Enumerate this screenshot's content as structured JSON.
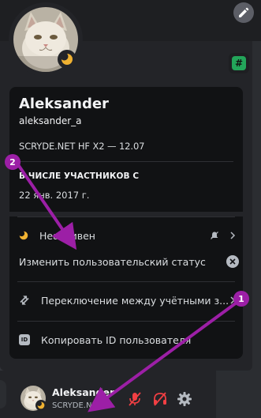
{
  "profile": {
    "display_name": "Aleksander",
    "username": "aleksander_a",
    "custom_status": "SCRYDE.NET HF X2 — 12.07",
    "member_since_title": "В ЧИСЛЕ УЧАСТНИКОВ С",
    "member_since_date": "22 янв. 2017 г.",
    "badge_symbol": "#"
  },
  "menu": {
    "status_label": "Неактивен",
    "edit_status_label": "Изменить пользовательский статус",
    "switch_accounts_label": "Переключение между учётными з...",
    "copy_id_label": "Копировать ID пользователя"
  },
  "user_bar": {
    "name": "Aleksander",
    "status": "SCRYDE.NET..."
  },
  "annotations": {
    "marker_1": "1",
    "marker_2": "2"
  },
  "colors": {
    "idle_moon": "#f0b232",
    "annotation": "#9c1fa6",
    "mute_red": "#f23f43",
    "badge_green": "#23a55a"
  },
  "icons": [
    "pencil-icon",
    "moon-icon",
    "hashtag-badge-icon",
    "chevron-right-icon",
    "clear-icon",
    "switch-accounts-icon",
    "id-icon",
    "mic-muted-icon",
    "headphones-muted-icon",
    "gear-icon"
  ]
}
